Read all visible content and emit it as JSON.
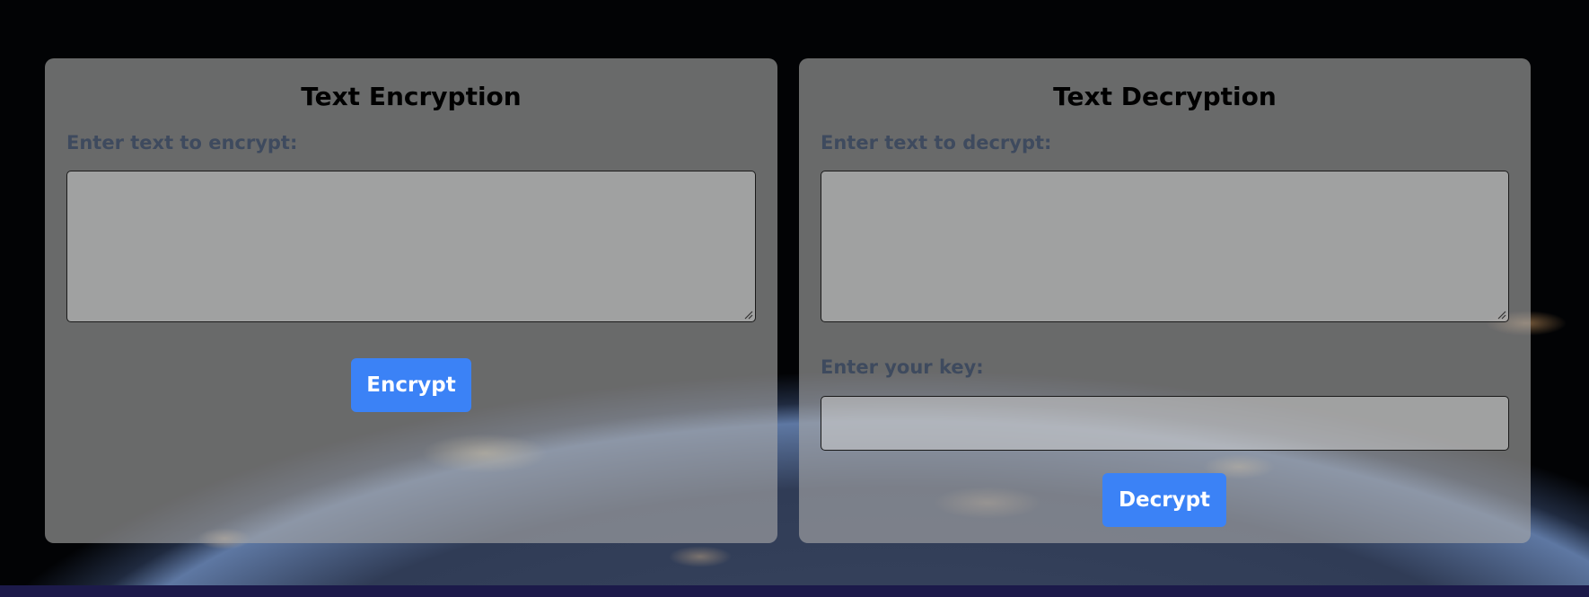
{
  "encryption": {
    "title": "Text Encryption",
    "input_label": "Enter text to encrypt:",
    "input_value": "",
    "input_placeholder": "",
    "button_label": "Encrypt"
  },
  "decryption": {
    "title": "Text Decryption",
    "input_label": "Enter text to decrypt:",
    "input_value": "",
    "input_placeholder": "",
    "key_label": "Enter your key:",
    "key_value": "",
    "key_placeholder": "",
    "button_label": "Decrypt"
  },
  "colors": {
    "button": "#3b82f6",
    "label": "#3e4a5e",
    "panel": "rgba(170,170,170,0.62)"
  },
  "icons": [
    "resize-grip-icon"
  ]
}
